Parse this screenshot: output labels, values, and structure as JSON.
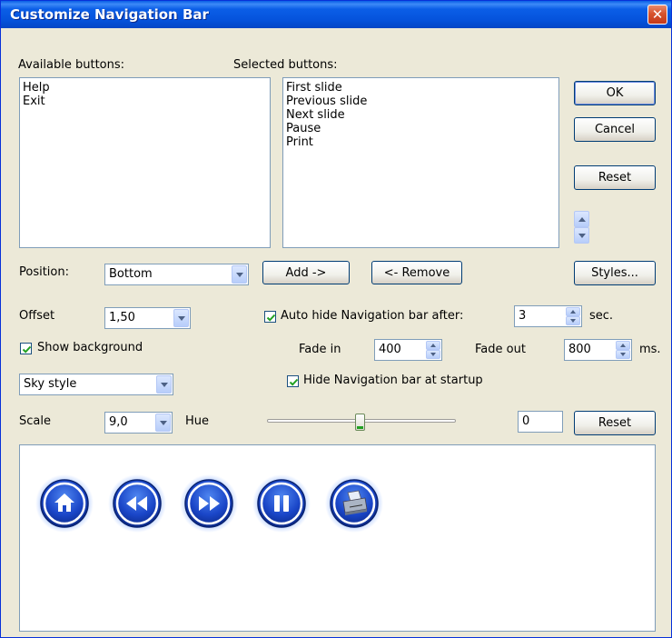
{
  "window": {
    "title": "Customize Navigation Bar",
    "close_symbol": "✕"
  },
  "available": {
    "label": "Available buttons:",
    "items": [
      "Help",
      "Exit"
    ]
  },
  "selected": {
    "label": "Selected buttons:",
    "items": [
      "First slide",
      "Previous slide",
      "Next slide",
      "Pause",
      "Print"
    ]
  },
  "buttons": {
    "ok": "OK",
    "cancel": "Cancel",
    "reset_top": "Reset",
    "add": "Add ->",
    "remove": "<- Remove",
    "styles": "Styles...",
    "reset_bottom": "Reset"
  },
  "position": {
    "label": "Position:",
    "value": "Bottom"
  },
  "offset": {
    "label": "Offset",
    "value": "1,50"
  },
  "autohide": {
    "label": "Auto hide Navigation bar after:",
    "checked": true,
    "value": "3",
    "unit": "sec."
  },
  "show_background": {
    "label": "Show background",
    "checked": true
  },
  "fade": {
    "in_label": "Fade in",
    "in_value": "400",
    "out_label": "Fade out",
    "out_value": "800",
    "unit": "ms."
  },
  "style_select": {
    "value": "Sky style"
  },
  "hide_at_startup": {
    "label": "Hide Navigation bar at startup",
    "checked": true
  },
  "scale": {
    "label": "Scale",
    "value": "9,0"
  },
  "hue": {
    "label": "Hue",
    "value": "0",
    "slider_fraction": 0.47
  },
  "preview": {
    "buttons": [
      "home-icon",
      "rewind-icon",
      "fast-forward-icon",
      "pause-icon",
      "printer-icon"
    ],
    "accent": "#1a46c8"
  }
}
